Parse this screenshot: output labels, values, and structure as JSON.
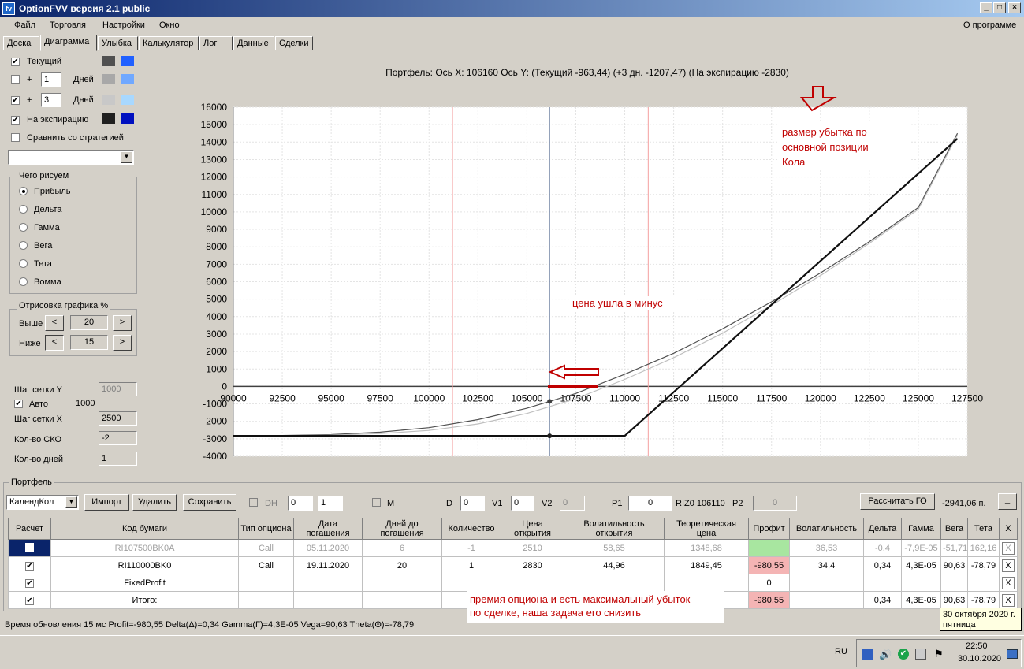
{
  "window": {
    "title": "OptionFVV версия 2.1 public"
  },
  "menu": {
    "file": "Файл",
    "trade": "Торговля",
    "settings": "Настройки",
    "window": "Окно",
    "about": "О программе"
  },
  "tabs": [
    "Доска",
    "Диаграмма",
    "Улыбка",
    "Калькулятор",
    "Лог",
    "Данные",
    "Сделки"
  ],
  "left": {
    "current": "Текущий",
    "plus": "+",
    "days_label": "Дней",
    "days1": "1",
    "days2": "3",
    "expiry": "На экспирацию",
    "compare": "Сравнить со стратегией",
    "what_title": "Чего рисуем",
    "radios": [
      "Прибыль",
      "Дельта",
      "Гамма",
      "Вега",
      "Тета",
      "Вомма"
    ],
    "draw_title": "Отрисовка графика %",
    "above": "Выше",
    "below": "Ниже",
    "above_val": "20",
    "below_val": "15",
    "lt": "<",
    "gt": ">",
    "grid_y": "Шаг сетки Y",
    "grid_y_val": "1000",
    "auto": "Авто",
    "auto_val": "1000",
    "grid_x": "Шаг сетки X",
    "grid_x_val": "2500",
    "sko": "Кол-во СКО",
    "sko_val": "-2",
    "ndays": "Кол-во дней",
    "ndays_val": "1"
  },
  "colors": {
    "current_dark": "#505050",
    "current_light": "#2060ff",
    "d1_dark": "#a8a8a8",
    "d1_light": "#70a8ff",
    "d2_dark": "#c8c8c8",
    "d2_light": "#a8d8ff",
    "exp_dark": "#202020",
    "exp_light": "#0010c0",
    "annot": "#c00000"
  },
  "chart_header": "Портфель: Ось Х: 106160 Ось Y:  (Текущий -963,44)  (+3 дн. -1207,47)  (На экспирацию -2830)",
  "annotations": {
    "a1": [
      "размер убытка по",
      "основной позиции",
      "Кола"
    ],
    "a2": "цена ушла в минус",
    "a3": [
      "премия опциона и есть максимальный убыток",
      "по сделке, наша задача его снизить"
    ]
  },
  "chart_data": {
    "type": "line",
    "xlim": [
      90000,
      127500
    ],
    "ylim": [
      -4000,
      16000
    ],
    "x_ticks": [
      90000,
      92500,
      95000,
      97500,
      100000,
      102500,
      105000,
      107500,
      110000,
      112500,
      115000,
      117500,
      120000,
      122500,
      125000,
      127500
    ],
    "y_ticks": [
      16000,
      15000,
      14000,
      13000,
      12000,
      11000,
      10000,
      9000,
      8000,
      7000,
      6000,
      5000,
      4000,
      3000,
      2000,
      1000,
      0,
      -1000,
      -2000,
      -3000,
      -4000
    ],
    "grid": true,
    "current_x": 106160,
    "sd_lines": [
      101200,
      111200
    ],
    "series": [
      {
        "name": "Текущий",
        "x": [
          90000,
          92500,
          95000,
          97500,
          100000,
          102500,
          105000,
          107500,
          110000,
          112500,
          115000,
          117500,
          120000,
          122500,
          125000,
          127000
        ],
        "y": [
          -2830,
          -2810,
          -2760,
          -2620,
          -2360,
          -1900,
          -1250,
          -400,
          700,
          1900,
          3300,
          4850,
          6500,
          8300,
          10250,
          14500
        ]
      },
      {
        "name": "+3 дн.",
        "x": [
          90000,
          92500,
          95000,
          97500,
          100000,
          102500,
          105000,
          107500,
          110000,
          112500,
          115000,
          117500,
          120000,
          122500,
          125000,
          127000
        ],
        "y": [
          -2830,
          -2820,
          -2790,
          -2700,
          -2520,
          -2150,
          -1550,
          -700,
          400,
          1650,
          3050,
          4650,
          6350,
          8200,
          10150,
          14400
        ]
      },
      {
        "name": "На экспирацию",
        "x": [
          90000,
          110000,
          127000
        ],
        "y": [
          -2830,
          -2830,
          14200
        ]
      }
    ]
  },
  "portfolio": {
    "title": "Портфель",
    "strategy": "КалендКол",
    "import": "Импорт",
    "delete": "Удалить",
    "save": "Сохранить",
    "dh": "DH",
    "spin1": "0",
    "spin2": "1",
    "m": "M",
    "d_label": "D",
    "d_val": "0",
    "v1_label": "V1",
    "v1_val": "0",
    "v2_label": "V2",
    "v2_val": "0",
    "p1_label": "P1",
    "p1_val": "0",
    "riz": "RIZ0 106110",
    "p2_label": "P2",
    "p2_val": "0",
    "calc_go": "Рассчитать ГО",
    "go_val": "-2941,06 п.",
    "minimize": "_"
  },
  "table": {
    "headers": [
      "Расчет",
      "Код бумаги",
      "Тип опциона",
      "Дата погашения",
      "Дней до погашения",
      "Количество",
      "Цена открытия",
      "Волатильность открытия",
      "Теоретическая цена",
      "Профит",
      "Волатильность",
      "Дельта",
      "Гамма",
      "Вега",
      "Тета",
      "X"
    ],
    "rows": [
      [
        "",
        "RI107500BK0A",
        "Call",
        "05.11.2020",
        "6",
        "-1",
        "2510",
        "58,65",
        "1348,68",
        "",
        "36,53",
        "-0,4",
        "-7,9E-05",
        "-51,71",
        "162,16",
        "X"
      ],
      [
        "✔",
        "RI110000BK0",
        "Call",
        "19.11.2020",
        "20",
        "1",
        "2830",
        "44,96",
        "1849,45",
        "-980,55",
        "34,4",
        "0,34",
        "4,3E-05",
        "90,63",
        "-78,79",
        "X"
      ],
      [
        "✔",
        "FixedProfit",
        "",
        "",
        "",
        "",
        "",
        "",
        "",
        "0",
        "",
        "",
        "",
        "",
        "",
        "X"
      ],
      [
        "✔",
        "Итого:",
        "",
        "",
        "",
        "",
        "",
        "",
        "",
        "-980,55",
        "",
        "0,34",
        "4,3E-05",
        "90,63",
        "-78,79",
        "X"
      ]
    ]
  },
  "status": "Время обновления 15 мс  Profit=-980,55 Delta(Δ)=0,34 Gamma(Г)=4,3E-05 Vega=90,63 Theta(Θ)=-78,79",
  "tooltip": [
    "30 октября 2020 г.",
    "пятница"
  ],
  "tray": {
    "lang": "RU",
    "time": "22:50",
    "date": "30.10.2020"
  }
}
